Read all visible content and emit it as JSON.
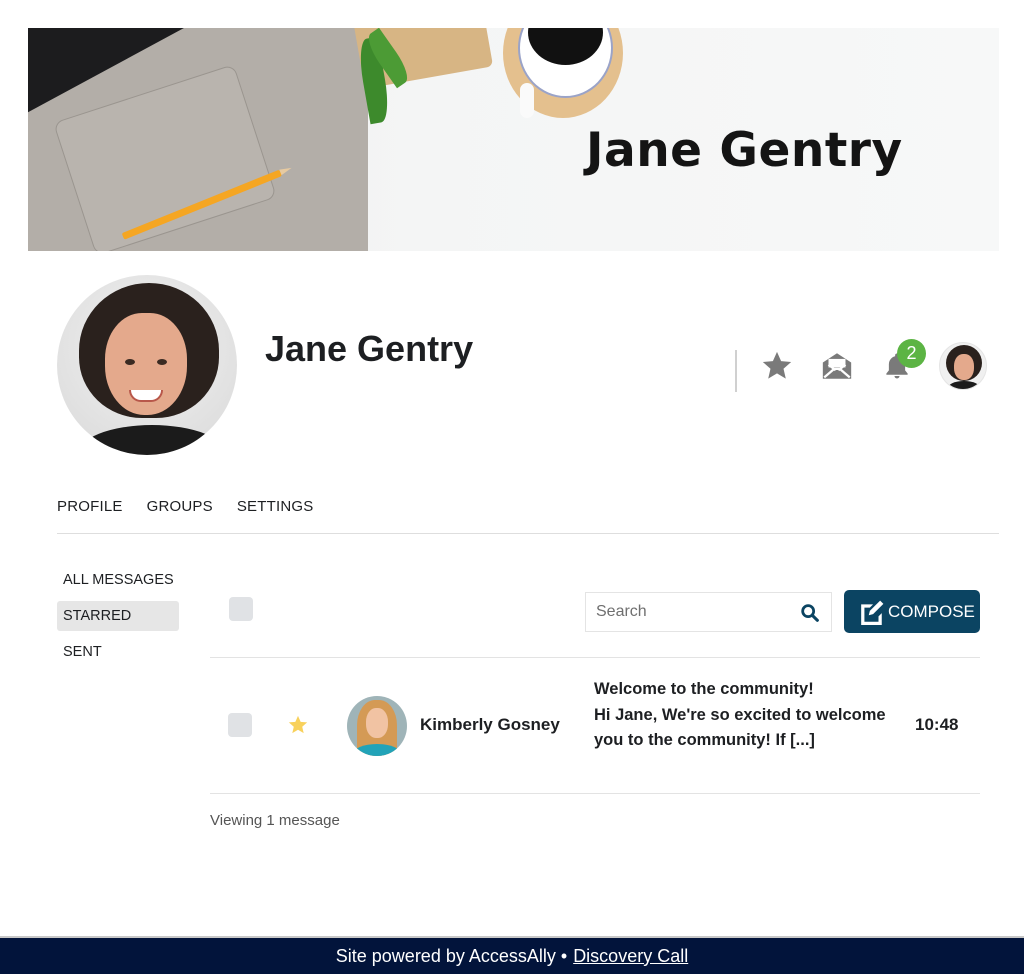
{
  "cover": {
    "title": "Jane Gentry"
  },
  "profile": {
    "name": "Jane Gentry"
  },
  "header_icons": {
    "starred_icon": "star-icon",
    "messages_icon": "envelope-open-icon",
    "notifications_icon": "bell-icon",
    "notification_count": "2",
    "badge_color": "#5cb444"
  },
  "tabs": [
    {
      "label": "PROFILE"
    },
    {
      "label": "GROUPS"
    },
    {
      "label": "SETTINGS"
    }
  ],
  "sidebar": {
    "items": [
      {
        "label": "ALL MESSAGES",
        "active": false
      },
      {
        "label": "STARRED",
        "active": true
      },
      {
        "label": "SENT",
        "active": false
      }
    ]
  },
  "toolbar": {
    "search_placeholder": "Search",
    "search_value": "",
    "compose_label": "COMPOSE",
    "compose_color": "#0b4462"
  },
  "messages": [
    {
      "sender": "Kimberly Gosney",
      "starred": true,
      "star_color": "#f8d15c",
      "subject": "Welcome to the community!",
      "preview": "Hi Jane, We're so excited to welcome you to the community! If [...]",
      "time": "10:48"
    }
  ],
  "status": {
    "viewing": "Viewing 1 message"
  },
  "footer": {
    "text": "Site powered by AccessAlly •",
    "link_label": "Discovery Call",
    "background": "#02143b"
  }
}
